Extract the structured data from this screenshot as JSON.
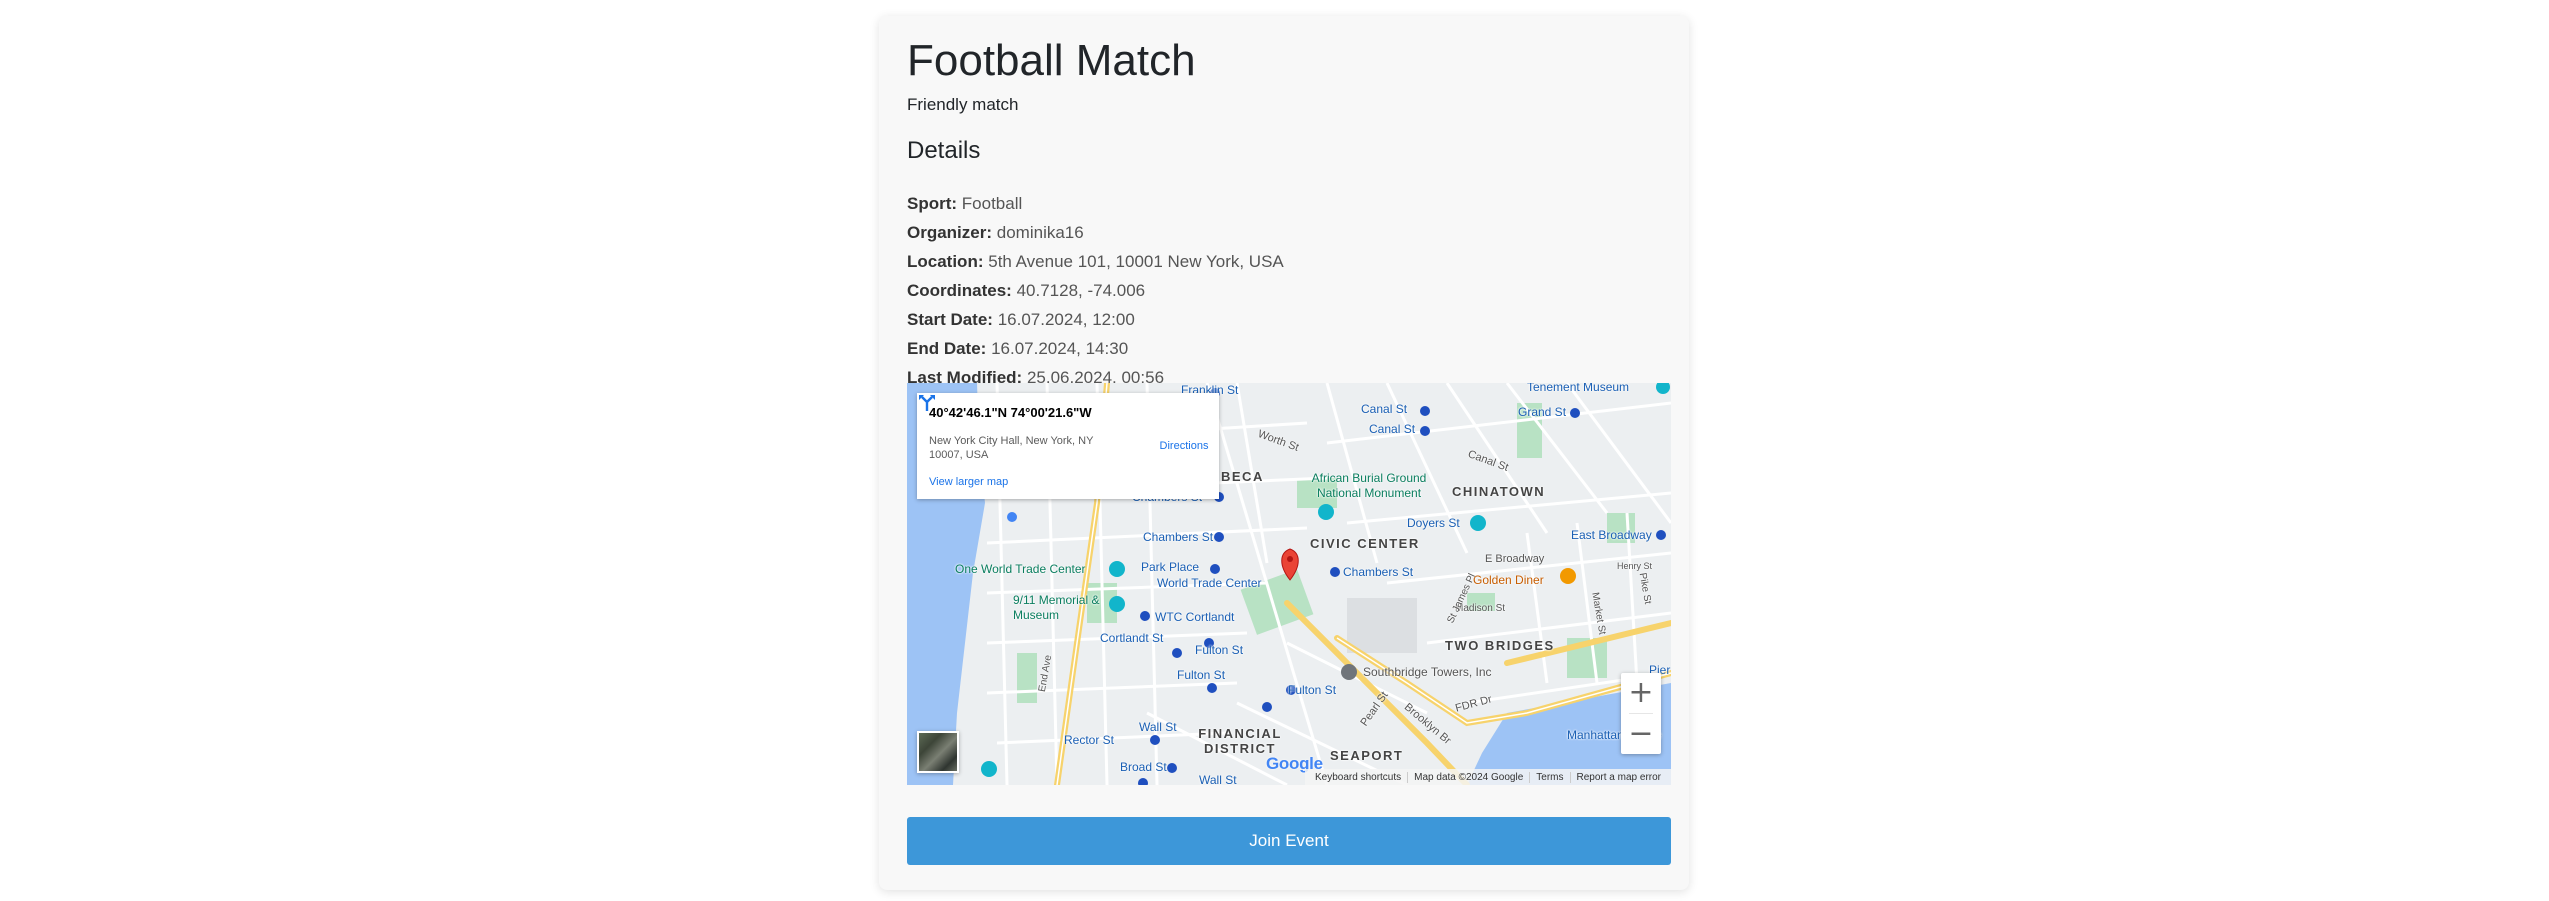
{
  "event": {
    "title": "Football Match",
    "description": "Friendly match",
    "details_heading": "Details",
    "fields": [
      {
        "label": "Sport:",
        "value": "Football"
      },
      {
        "label": "Organizer:",
        "value": "dominika16"
      },
      {
        "label": "Location:",
        "value": "5th Avenue 101, 10001 New York, USA"
      },
      {
        "label": "Coordinates:",
        "value": "40.7128, -74.006"
      },
      {
        "label": "Start Date:",
        "value": "16.07.2024, 12:00"
      },
      {
        "label": "End Date:",
        "value": "16.07.2024, 14:30"
      },
      {
        "label": "Last Modified:",
        "value": "25.06.2024, 00:56"
      }
    ],
    "join_button": "Join Event"
  },
  "map": {
    "info": {
      "coords": "40°42'46.1\"N 74°00'21.6\"W",
      "address": "New York City Hall, New York, NY 10007, USA",
      "directions": "Directions",
      "view_larger": "View larger map"
    },
    "zoom_in": "+",
    "zoom_out": "−",
    "logo": "Google",
    "attribution": [
      "Keyboard shortcuts",
      "Map data ©2024 Google",
      "Terms",
      "Report a map error"
    ],
    "labels": {
      "franklin_st": "Franklin St",
      "canal_st_1": "Canal St",
      "canal_st_2": "Canal St",
      "grand_st": "Grand St",
      "tenement": "Tenement Museum",
      "worth_st": "Worth St",
      "canal_st_road": "Canal St",
      "tribeca": "BECA",
      "african_burial": "African Burial Ground National Monument",
      "chinatown": "CHINATOWN",
      "chambers_st_1": "Chambers St",
      "chambers_st_2": "Chambers St",
      "chambers_st_3": "Chambers St",
      "doyers_st": "Doyers St",
      "east_broadway": "East Broadway",
      "civic_center": "CIVIC CENTER",
      "one_wtc": "One World Trade Center",
      "park_place": "Park Place",
      "world_trade_center": "World Trade Center",
      "e_broadway": "E Broadway",
      "golden_diner": "Golden Diner",
      "henry_st": "Henry St",
      "memorial": "9/11 Memorial & Museum",
      "wtc_cortlandt": "WTC Cortlandt",
      "cortlandt_st": "Cortlandt St",
      "madison_st": "Madison St",
      "fulton_st_1": "Fulton St",
      "fulton_st_2": "Fulton St",
      "fulton_st_3": "Fulton St",
      "two_bridges": "TWO BRIDGES",
      "southbridge": "Southbridge Towers, Inc",
      "pier": "Pier",
      "wall_st_1": "Wall St",
      "wall_st_2": "Wall St",
      "rector_st": "Rector St",
      "broad_st": "Broad St",
      "financial_district": "FINANCIAL DISTRICT",
      "seaport": "SEAPORT",
      "manhattan_bridge": "Manhattan Bridge",
      "fdr_dr": "FDR Dr",
      "brooklyn_br": "Brooklyn Br",
      "pearl_st": "Pearl St",
      "st_james_pl": "St James Pl",
      "pike_st": "Pike St",
      "market_st": "Market St",
      "end_ave": "End Ave"
    }
  }
}
